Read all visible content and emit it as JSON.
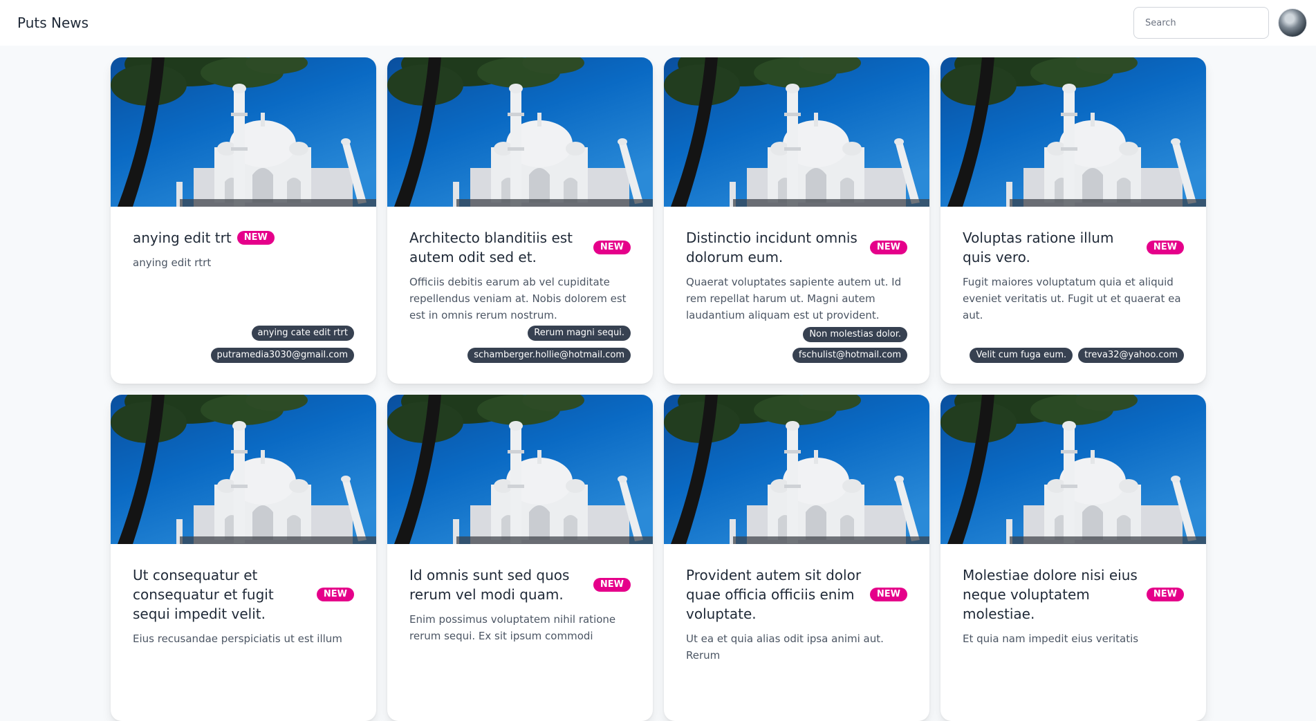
{
  "app": {
    "brand": "Puts News"
  },
  "search": {
    "placeholder": "Search"
  },
  "badge_label": "NEW",
  "cards": [
    {
      "title": "anying edit trt",
      "description": "anying edit rtrt",
      "category": "anying cate edit rtrt",
      "author": "putramedia3030@gmail.com"
    },
    {
      "title": "Architecto blanditiis est autem odit sed et.",
      "description": "Officiis debitis earum ab vel cupiditate repellendus veniam at. Nobis dolorem est est in omnis rerum nostrum.",
      "category": "Rerum magni sequi.",
      "author": "schamberger.hollie@hotmail.com"
    },
    {
      "title": "Distinctio incidunt omnis dolorum eum.",
      "description": "Quaerat voluptates sapiente autem ut. Id rem repellat harum ut. Magni autem laudantium aliquam est ut provident.",
      "category": "Non molestias dolor.",
      "author": "fschulist@hotmail.com"
    },
    {
      "title": "Voluptas ratione illum quis vero.",
      "description": "Fugit maiores voluptatum quia et aliquid eveniet veritatis ut. Fugit ut et quaerat ea aut.",
      "category": "Velit cum fuga eum.",
      "author": "treva32@yahoo.com"
    },
    {
      "title": "Ut consequatur et consequatur et fugit sequi impedit velit.",
      "description": "Eius recusandae perspiciatis ut est illum"
    },
    {
      "title": "Id omnis sunt sed quos rerum vel modi quam.",
      "description": "Enim possimus voluptatem nihil ratione rerum sequi. Ex sit ipsum commodi"
    },
    {
      "title": "Provident autem sit dolor quae officia officiis enim voluptate.",
      "description": "Ut ea et quia alias odit ipsa animi aut. Rerum"
    },
    {
      "title": "Molestiae dolore nisi eius neque voluptatem molestiae.",
      "description": "Et quia nam impedit eius veritatis"
    }
  ],
  "colors": {
    "badge": "#e5008a",
    "tag": "#374151",
    "sky": "#0a63b8"
  },
  "icons": {
    "card_image": "taj-mahal-photo"
  }
}
